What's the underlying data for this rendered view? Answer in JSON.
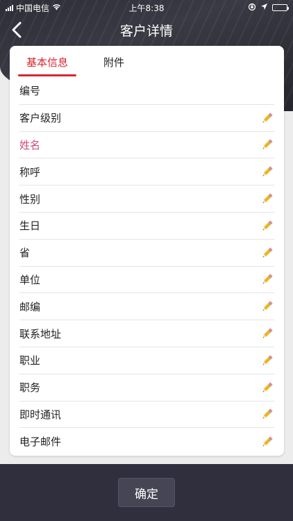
{
  "status_bar": {
    "carrier": "中国电信",
    "time": "上午8:38",
    "wifi_icon": "wifi-icon",
    "location_icon": "location-arrow-icon",
    "lock_icon": "orientation-lock-icon"
  },
  "header": {
    "title": "客户详情",
    "back_icon": "chevron-left-icon"
  },
  "tabs": [
    {
      "label": "基本信息",
      "active": true
    },
    {
      "label": "附件",
      "active": false
    }
  ],
  "fields": [
    {
      "label": "编号",
      "editable": false,
      "required": false
    },
    {
      "label": "客户级别",
      "editable": true,
      "required": false
    },
    {
      "label": "姓名",
      "editable": true,
      "required": true
    },
    {
      "label": "称呼",
      "editable": true,
      "required": false
    },
    {
      "label": "性别",
      "editable": true,
      "required": false
    },
    {
      "label": "生日",
      "editable": true,
      "required": false
    },
    {
      "label": "省",
      "editable": true,
      "required": false
    },
    {
      "label": "单位",
      "editable": true,
      "required": false
    },
    {
      "label": "邮编",
      "editable": true,
      "required": false
    },
    {
      "label": "联系地址",
      "editable": true,
      "required": false
    },
    {
      "label": "职业",
      "editable": true,
      "required": false
    },
    {
      "label": "职务",
      "editable": true,
      "required": false
    },
    {
      "label": "即时通讯",
      "editable": true,
      "required": false
    },
    {
      "label": "电子邮件",
      "editable": true,
      "required": false
    }
  ],
  "footer": {
    "confirm_label": "确定"
  },
  "colors": {
    "accent": "#d7262f",
    "required_label": "#d14a7a",
    "header_bg": "#2e2e38",
    "footer_bg": "#2f2f3d"
  }
}
